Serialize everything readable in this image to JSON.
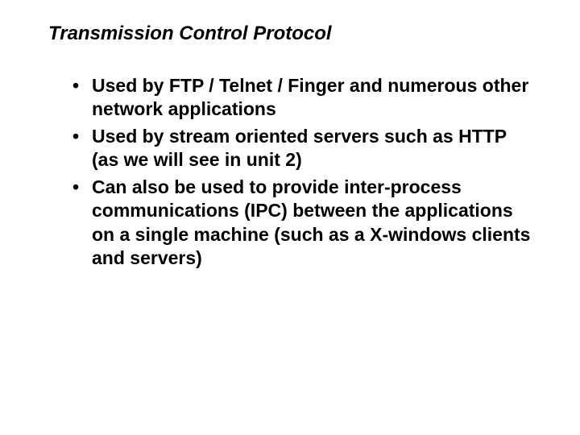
{
  "slide": {
    "title": "Transmission Control Protocol",
    "bullets": [
      "Used by FTP / Telnet / Finger and numerous other network applications",
      "Used by stream oriented servers such as HTTP (as we will see in unit 2)",
      "Can also be used to provide inter-process communications (IPC) between the applications on a single machine (such as a X-windows clients and servers)"
    ]
  }
}
